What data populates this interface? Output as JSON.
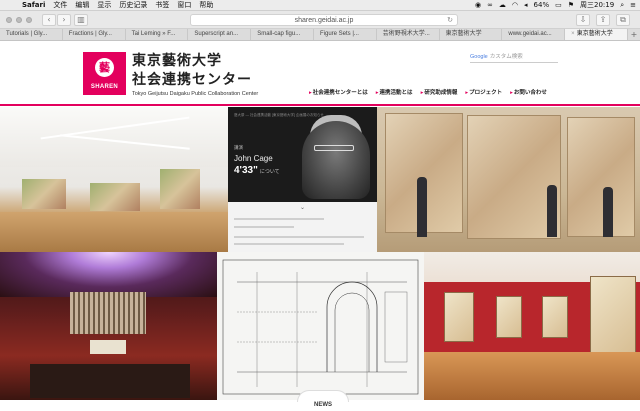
{
  "menubar": {
    "app": "Safari",
    "items": [
      "文件",
      "编辑",
      "显示",
      "历史记录",
      "书签",
      "窗口",
      "帮助"
    ],
    "battery": "64%",
    "clock": "周三20:19"
  },
  "browser": {
    "url": "sharen.geidai.ac.jp",
    "tabs": [
      {
        "label": "Tutorials | Gly..."
      },
      {
        "label": "Fractions | Gly..."
      },
      {
        "label": "Tai Leming » F..."
      },
      {
        "label": "Superscript an..."
      },
      {
        "label": "Small-cap figu..."
      },
      {
        "label": "Figure Sets |..."
      },
      {
        "label": "芸術野視术大学..."
      },
      {
        "label": "東京藝術大学"
      },
      {
        "label": "www.geidai.ac..."
      },
      {
        "label": "東京藝術大学"
      }
    ],
    "active_tab_index": 9
  },
  "site": {
    "logo_text": "SHAREN",
    "logo_mark": "藝",
    "name_line1": "東京藝術大学",
    "name_line2": "社会連携センター",
    "name_en": "Tokyo Geijutsu Daigaku  Public Collaboration Center",
    "search_prefix": "Google",
    "search_placeholder": "カスタム検索",
    "nav": [
      {
        "label": "社会連携センターとは"
      },
      {
        "label": "連携活動とは"
      },
      {
        "label": "研究助成情報"
      },
      {
        "label": "プロジェクト"
      },
      {
        "label": "お問い合わせ"
      }
    ],
    "colors": {
      "accent": "#e3005d"
    }
  },
  "feature": {
    "header": "藝大祭 — 社会連携活動 [東京藝術大学] 企画展のお知らせ",
    "label": "講演",
    "name": "John Cage",
    "piece": "4'33\"",
    "piece_suffix": "について"
  },
  "news_tab": "NEWS"
}
